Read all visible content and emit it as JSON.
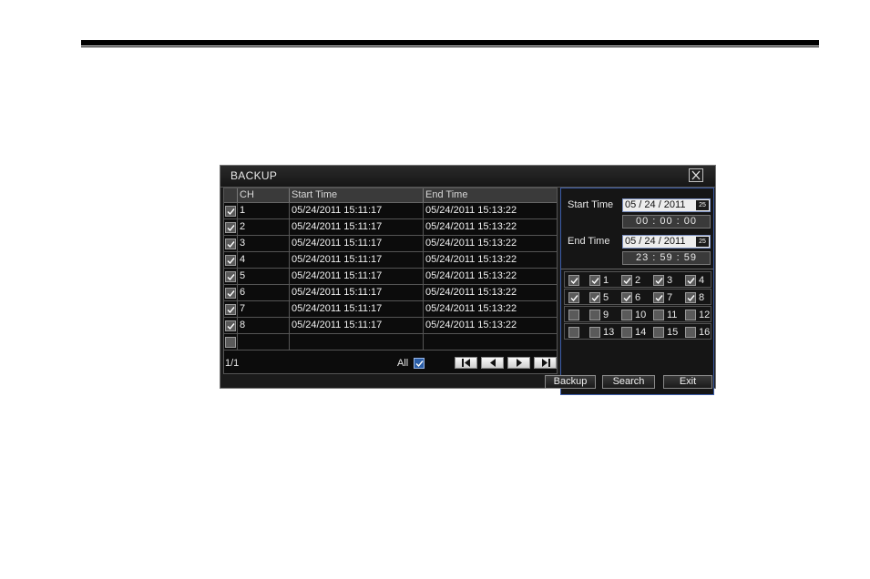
{
  "window": {
    "title": "BACKUP"
  },
  "table": {
    "headers": {
      "ch": "CH",
      "start": "Start Time",
      "end": "End Time"
    },
    "rows": [
      {
        "ch": "1",
        "start": "05/24/2011 15:11:17",
        "end": "05/24/2011 15:13:22",
        "checked": true
      },
      {
        "ch": "2",
        "start": "05/24/2011 15:11:17",
        "end": "05/24/2011 15:13:22",
        "checked": true
      },
      {
        "ch": "3",
        "start": "05/24/2011 15:11:17",
        "end": "05/24/2011 15:13:22",
        "checked": true
      },
      {
        "ch": "4",
        "start": "05/24/2011 15:11:17",
        "end": "05/24/2011 15:13:22",
        "checked": true
      },
      {
        "ch": "5",
        "start": "05/24/2011 15:11:17",
        "end": "05/24/2011 15:13:22",
        "checked": true
      },
      {
        "ch": "6",
        "start": "05/24/2011 15:11:17",
        "end": "05/24/2011 15:13:22",
        "checked": true
      },
      {
        "ch": "7",
        "start": "05/24/2011 15:11:17",
        "end": "05/24/2011 15:13:22",
        "checked": true
      },
      {
        "ch": "8",
        "start": "05/24/2011 15:11:17",
        "end": "05/24/2011 15:13:22",
        "checked": true
      },
      {
        "ch": "",
        "start": "",
        "end": "",
        "checked": false
      }
    ],
    "pager": "1/1",
    "all_label": "All",
    "all_checked": true
  },
  "search": {
    "start_label": "Start Time",
    "start_date": "05 / 24 / 2011",
    "start_time": "00  :  00  :  00",
    "end_label": "End Time",
    "end_date": "05 / 24 / 2011",
    "end_time": "23  :  59  :  59",
    "calendar_icon_text": "25"
  },
  "channels": {
    "rows": [
      {
        "all": true,
        "items": [
          {
            "label": "1",
            "checked": true
          },
          {
            "label": "2",
            "checked": true
          },
          {
            "label": "3",
            "checked": true
          },
          {
            "label": "4",
            "checked": true
          }
        ]
      },
      {
        "all": true,
        "items": [
          {
            "label": "5",
            "checked": true
          },
          {
            "label": "6",
            "checked": true
          },
          {
            "label": "7",
            "checked": true
          },
          {
            "label": "8",
            "checked": true
          }
        ]
      },
      {
        "all": false,
        "items": [
          {
            "label": "9",
            "checked": false
          },
          {
            "label": "10",
            "checked": false
          },
          {
            "label": "11",
            "checked": false
          },
          {
            "label": "12",
            "checked": false
          }
        ]
      },
      {
        "all": false,
        "items": [
          {
            "label": "13",
            "checked": false
          },
          {
            "label": "14",
            "checked": false
          },
          {
            "label": "15",
            "checked": false
          },
          {
            "label": "16",
            "checked": false
          }
        ]
      }
    ]
  },
  "buttons": {
    "backup": "Backup",
    "search": "Search",
    "exit": "Exit"
  }
}
